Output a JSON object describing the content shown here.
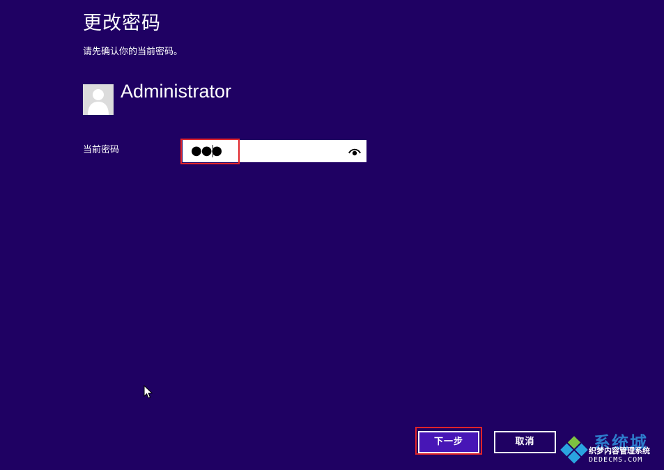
{
  "header": {
    "title": "更改密码",
    "subtitle": "请先确认你的当前密码。"
  },
  "account": {
    "username": "Administrator",
    "avatar_icon": "user-silhouette-icon"
  },
  "form": {
    "current_password_label": "当前密码",
    "current_password_value": "●●●",
    "reveal_icon": "eye-icon"
  },
  "buttons": {
    "next_label": "下一步",
    "cancel_label": "取消"
  },
  "watermark": {
    "brand": "系统城",
    "tagline": "织梦内容管理系统",
    "url": "DEDECMS.COM"
  },
  "colors": {
    "background": "#1f0163",
    "primary_button": "#4716b6",
    "highlight": "#e0242a",
    "text": "#ffffff"
  }
}
